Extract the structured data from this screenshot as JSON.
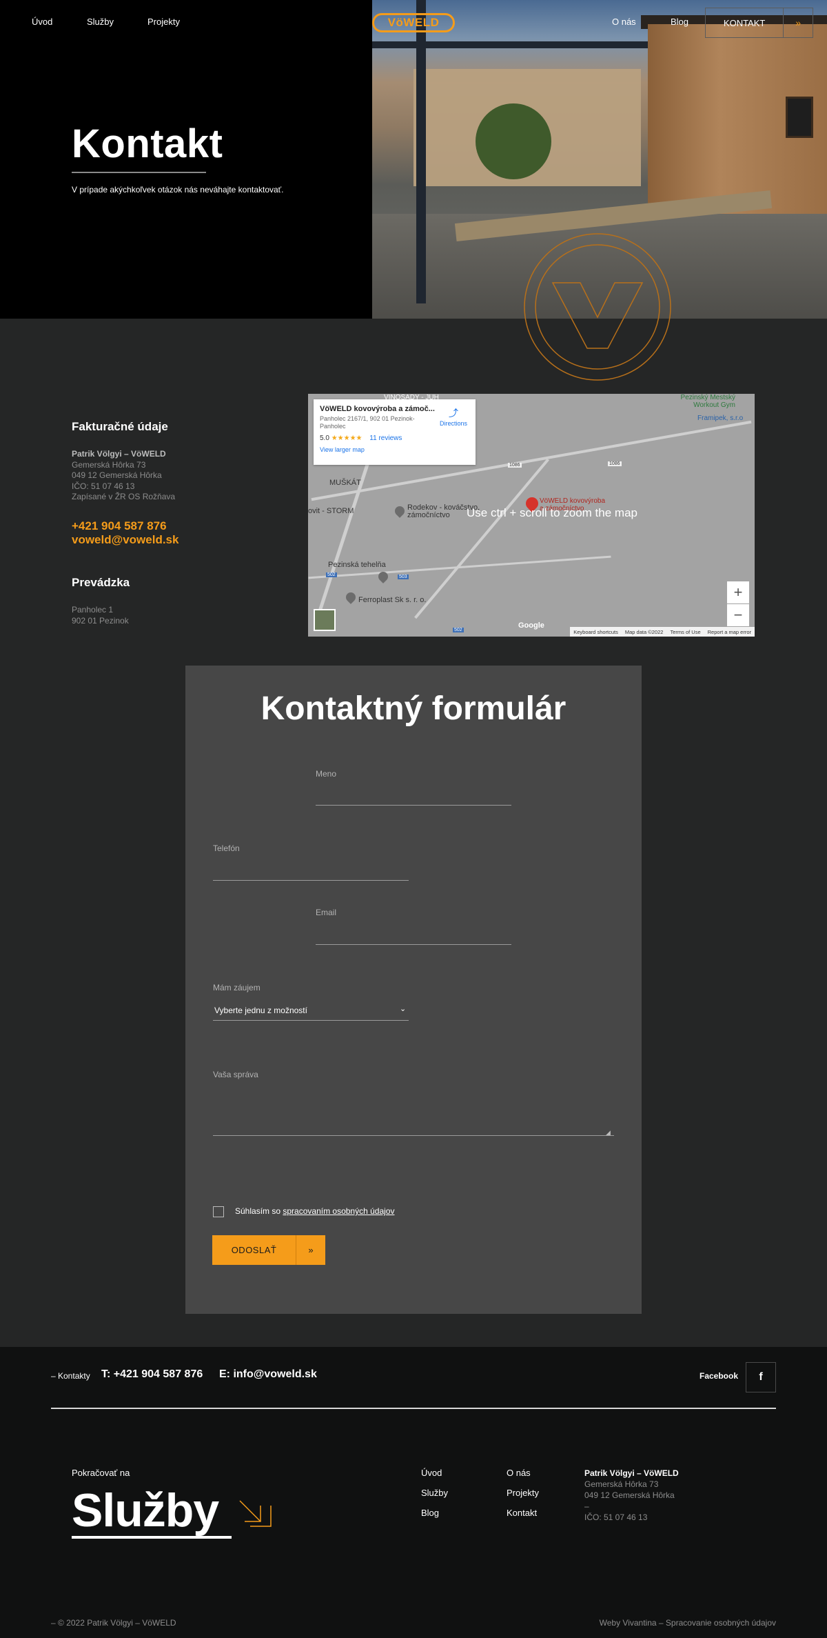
{
  "nav": {
    "left": [
      "Úvod",
      "Služby",
      "Projekty"
    ],
    "right": [
      "O nás",
      "Blog"
    ],
    "logo": "VöWELD",
    "cta_label": "KONTAKT",
    "cta_arrow": "»"
  },
  "hero": {
    "title": "Kontakt",
    "subtitle": "V prípade akýchkoľvek otázok nás neváhajte kontaktovať."
  },
  "billing": {
    "heading": "Fakturačné údaje",
    "name": "Patrik Völgyi – VöWELD",
    "street": "Gemerská Hôrka 73",
    "city": "049 12 Gemerská Hôrka",
    "ico": "IČO: 51 07 46 13",
    "registry": "Zapísané v ŽR OS Rožňava",
    "phone": "+421 904 587 876",
    "email": "voweld@voweld.sk"
  },
  "workshop": {
    "heading": "Prevádzka",
    "street": "Panholec 1",
    "city": "902 01 Pezinok"
  },
  "map": {
    "card_title": "VöWELD kovovýroba a zámoč...",
    "card_address": "Panholec 2167/1, 902 01 Pezinok-Panholec",
    "card_directions": "Directions",
    "rating": "5.0",
    "stars": "★★★★★",
    "reviews": "11 reviews",
    "larger_map": "View larger map",
    "hint": "Use ctrl + scroll to zoom the map",
    "labels": {
      "vinosady": "VINOSADY - JUH",
      "muskat": "MUŠKÁT",
      "storm": "ovit - STORM",
      "rodekov": "Rodekov - kováčstvo, zámočníctvo",
      "tehelna": "Pezinská tehelňa",
      "ferroplast": "Ferroplast Sk s. r. o.",
      "voweld": "VöWELD kovovýroba a zámočníctvo",
      "workout": "Pezinský Mestský Workout Gym",
      "framipek": "Framipek, s.r.o",
      "road_1086a": "1086",
      "road_1086b": "1086",
      "road_502": "502",
      "road_503": "503",
      "road_502b": "502"
    },
    "zoom_in": "+",
    "zoom_out": "−",
    "google": "Google",
    "footer": [
      "Keyboard shortcuts",
      "Map data ©2022",
      "Terms of Use",
      "Report a map error"
    ]
  },
  "form": {
    "title": "Kontaktný formulár",
    "name_label": "Meno",
    "phone_label": "Telefón",
    "email_label": "Email",
    "interest_label": "Mám záujem",
    "interest_value": "Vyberte jednu z možností",
    "message_label": "Vaša správa",
    "consent_prefix": "Súhlasím so",
    "consent_link": "spracovaním osobných údajov",
    "submit_label": "ODOSLAŤ",
    "submit_arrow": "»"
  },
  "footer": {
    "contacts_label": "– Kontakty",
    "phone": "T: +421 904 587 876",
    "email": "E: info@voweld.sk",
    "facebook_label": "Facebook",
    "facebook_icon": "f",
    "continue_label": "Pokračovať na",
    "continue_target": "Služby",
    "links_col1": [
      "Úvod",
      "Služby",
      "Blog"
    ],
    "links_col2": [
      "O nás",
      "Projekty",
      "Kontakt"
    ],
    "company": "Patrik Völgyi – VöWELD",
    "street": "Gemerská Hôrka 73",
    "city": "049 12 Gemerská Hôrka",
    "dash": "–",
    "ico": "IČO: 51 07 46 13",
    "copyright": "– © 2022 Patrik Völgyi – VöWELD",
    "credits": "Weby Vivantina – Spracovanie osobných údajov"
  },
  "colors": {
    "accent": "#f59c1a",
    "page_bg": "#252626",
    "form_bg": "#474747",
    "footer_bg": "#101111"
  },
  "icons": [
    "logo-badge",
    "arrow-right-double",
    "facebook-icon",
    "map-pin",
    "directions-icon",
    "diagonal-arrow-icon"
  ]
}
